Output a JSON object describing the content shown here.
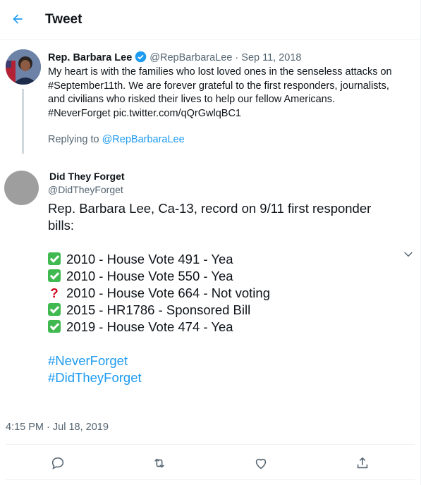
{
  "header": {
    "title": "Tweet",
    "back_icon": "arrow-left-icon"
  },
  "tweet1": {
    "name": "Rep. Barbara Lee",
    "handle": "@RepBarbaraLee",
    "separator": "·",
    "date": "Sep 11, 2018",
    "body_lines": [
      "My heart is with the families who lost loved ones in the senseless attacks on",
      "#September11th. We are forever grateful to the first responders, journalists,",
      "and civilians who risked their lives to help our fellow Americans.",
      "#NeverForget pic.twitter.com/qQrGwlqBC1"
    ],
    "replying_prefix": "Replying to",
    "replying_handle": "@RepBarbaraLee"
  },
  "tweet2": {
    "name": "Did They Forget",
    "handle": "@DidTheyForget",
    "intro_lines": [
      "Rep. Barbara Lee, Ca-13, record on 9/11 first responder",
      "bills:"
    ],
    "records": [
      {
        "icon": "check-mark-icon",
        "text": "2010 - House Vote 491 - Yea"
      },
      {
        "icon": "check-mark-icon",
        "text": "2010 - House Vote 550 - Yea"
      },
      {
        "icon": "question-mark-icon",
        "text": "2010 - House Vote 664 - Not voting"
      },
      {
        "icon": "check-mark-icon",
        "text": "2015 - HR1786 - Sponsored Bill"
      },
      {
        "icon": "check-mark-icon",
        "text": "2019 - House Vote 474 - Yea"
      }
    ],
    "hashtags": [
      "#NeverForget",
      "#DidTheyForget"
    ],
    "timestamp": "4:15 PM · Jul 18, 2019"
  },
  "colors": {
    "accent": "#1d9bf0",
    "check": "#3fb950",
    "question": "#d0021b",
    "muted": "#536471"
  },
  "actions": [
    "reply-icon",
    "retweet-icon",
    "like-icon",
    "share-icon"
  ]
}
